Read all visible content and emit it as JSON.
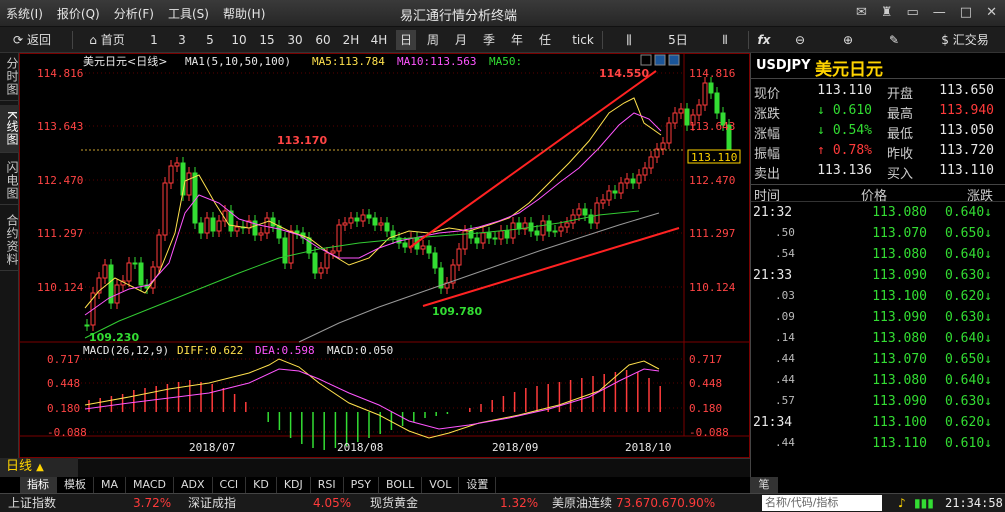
{
  "titlebar": {
    "menus": [
      "系统(I)",
      "报价(Q)",
      "分析(F)",
      "工具(S)",
      "帮助(H)"
    ],
    "title": "易汇通行情分析终端"
  },
  "toolbar": {
    "back": "返回",
    "home": "首页",
    "periods": [
      "1",
      "3",
      "5",
      "10",
      "15",
      "30",
      "60",
      "2H",
      "4H",
      "日",
      "周",
      "月",
      "季",
      "年",
      "任",
      "tick"
    ],
    "active_period": "日",
    "days": "5日",
    "fx": "fx",
    "trade": "汇交易"
  },
  "side_tabs": [
    "分时图",
    "K线图",
    "闪电图",
    "合约资料"
  ],
  "chart": {
    "legend_symbol": "美元日元<日线>",
    "legend_ma1": "MA1(5,10,50,100)",
    "legend_ma5": "MA5:113.784",
    "legend_ma10": "MA10:113.563",
    "legend_ma50": "MA50:",
    "price_ticks": [
      "114.816",
      "113.643",
      "112.470",
      "111.297",
      "110.124"
    ],
    "current_price": "113.110",
    "anno_high": "114.550",
    "anno_mid": "113.170",
    "anno_low1": "109.780",
    "anno_low2": "109.230",
    "macd_legend": "MACD(26,12,9)",
    "diff": "DIFF:0.622",
    "dea": "DEA:0.598",
    "macd": "MACD:0.050",
    "macd_ticks": [
      "0.717",
      "0.448",
      "0.180",
      "-0.088"
    ],
    "x_labels": [
      "2018/07",
      "2018/08",
      "2018/09",
      "2018/10"
    ]
  },
  "quote": {
    "symbol": "USDJPY",
    "name": "美元日元",
    "rows": [
      {
        "l1": "现价",
        "v1": "113.110",
        "c1": "wh",
        "l2": "开盘",
        "v2": "113.650",
        "c2": "wh"
      },
      {
        "l1": "涨跌",
        "v1": "0.610",
        "c1": "dn",
        "a1": "↓",
        "l2": "最高",
        "v2": "113.940",
        "c2": "up"
      },
      {
        "l1": "涨幅",
        "v1": "0.54%",
        "c1": "dn",
        "a1": "↓",
        "l2": "最低",
        "v2": "113.050",
        "c2": "wh"
      },
      {
        "l1": "振幅",
        "v1": "0.78%",
        "c1": "up",
        "a1": "↑",
        "l2": "昨收",
        "v2": "113.720",
        "c2": "wh"
      },
      {
        "l1": "卖出",
        "v1": "113.136",
        "c1": "wh",
        "l2": "买入",
        "v2": "113.110",
        "c2": "wh"
      }
    ],
    "tick_header": {
      "time": "时间",
      "price": "价格",
      "chg": "涨跌"
    },
    "ticks": [
      {
        "t": "21:32",
        "p": "113.080",
        "c": "0.640"
      },
      {
        "t": ".50",
        "p": "113.070",
        "c": "0.650"
      },
      {
        "t": ".54",
        "p": "113.080",
        "c": "0.640"
      },
      {
        "t": "21:33",
        "p": "113.090",
        "c": "0.630"
      },
      {
        "t": ".03",
        "p": "113.100",
        "c": "0.620"
      },
      {
        "t": ".09",
        "p": "113.090",
        "c": "0.630"
      },
      {
        "t": ".14",
        "p": "113.080",
        "c": "0.640"
      },
      {
        "t": ".44",
        "p": "113.070",
        "c": "0.650"
      },
      {
        "t": ".44",
        "p": "113.080",
        "c": "0.640"
      },
      {
        "t": ".57",
        "p": "113.090",
        "c": "0.630"
      },
      {
        "t": "21:34",
        "p": "113.100",
        "c": "0.620"
      },
      {
        "t": ".44",
        "p": "113.110",
        "c": "0.610"
      }
    ],
    "note_tab": "笔"
  },
  "bottom": {
    "period": "日线",
    "indicator_tabs": [
      "指标",
      "模板",
      "MA",
      "MACD",
      "ADX",
      "CCI",
      "KD",
      "KDJ",
      "RSI",
      "PSY",
      "BOLL",
      "VOL",
      "设置"
    ]
  },
  "status": {
    "items": [
      {
        "name": "上证指数",
        "val": "3.72%"
      },
      {
        "name": "深证成指",
        "val": "4.05%"
      },
      {
        "name": "现货黄金",
        "val": "1.32%"
      },
      {
        "name": "美原油连续",
        "val": "73.670.670.90%"
      }
    ],
    "search_placeholder": "名称/代码/指标",
    "time": "21:34:58"
  },
  "colors": {
    "up": "#ff3b3b",
    "down": "#33dd33",
    "accent": "#ffd400",
    "grid": "#7a0000"
  }
}
